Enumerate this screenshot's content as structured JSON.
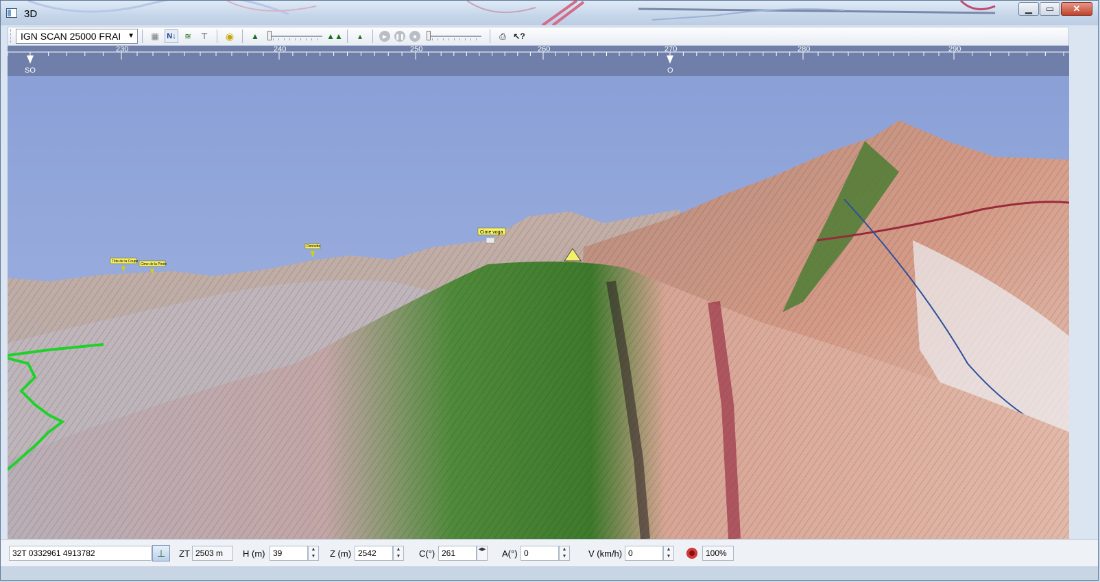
{
  "window": {
    "title": "3D",
    "buttons": [
      "minimize-icon",
      "maximize-icon",
      "close-icon"
    ]
  },
  "toolbar": {
    "map_layer": "IGN SCAN 25000 FRAI",
    "north_label": "N↓",
    "buttons": [
      "layers-icon",
      "north-up-icon",
      "terrain-icon",
      "pin-icon",
      "refresh-globe-icon",
      "mountain-icon",
      "zoom-slider",
      "mountains-icon",
      "mountain-small-icon",
      "play-icon",
      "pause-icon",
      "stop-icon",
      "speed-slider",
      "print-icon",
      "help-icon"
    ]
  },
  "compass": {
    "degree_labels": [
      {
        "value": "230",
        "deg": 230
      },
      {
        "value": "240",
        "deg": 240
      },
      {
        "value": "250",
        "deg": 250
      },
      {
        "value": "260",
        "deg": 260
      },
      {
        "value": "270",
        "deg": 270
      },
      {
        "value": "280",
        "deg": 280
      },
      {
        "value": "290",
        "deg": 290
      }
    ],
    "cardinals": [
      {
        "label": "SO",
        "deg": 225
      },
      {
        "label": "O",
        "deg": 270
      }
    ]
  },
  "scene": {
    "placemarks": [
      "Tête de la Coupe",
      "Cime de la Pinée",
      "Donnette",
      "Cime voga"
    ],
    "sky_color": "#8ea5d9",
    "terrain_colors": [
      "#d09a86",
      "#b9a49a",
      "#4b7a32",
      "#e0c2b5"
    ],
    "track_color": "#1fd12a"
  },
  "status": {
    "coordinates": "32T  0332961  4913782",
    "zt_label": "ZT",
    "zt_value": "2503 m",
    "h_label": "H (m)",
    "h_value": "39",
    "z_label": "Z (m)",
    "z_value": "2542",
    "c_label": "C(°)",
    "c_value": "261",
    "a_label": "A(°)",
    "a_value": "0",
    "v_label": "V (km/h)",
    "v_value": "0",
    "zoom": "100%"
  }
}
